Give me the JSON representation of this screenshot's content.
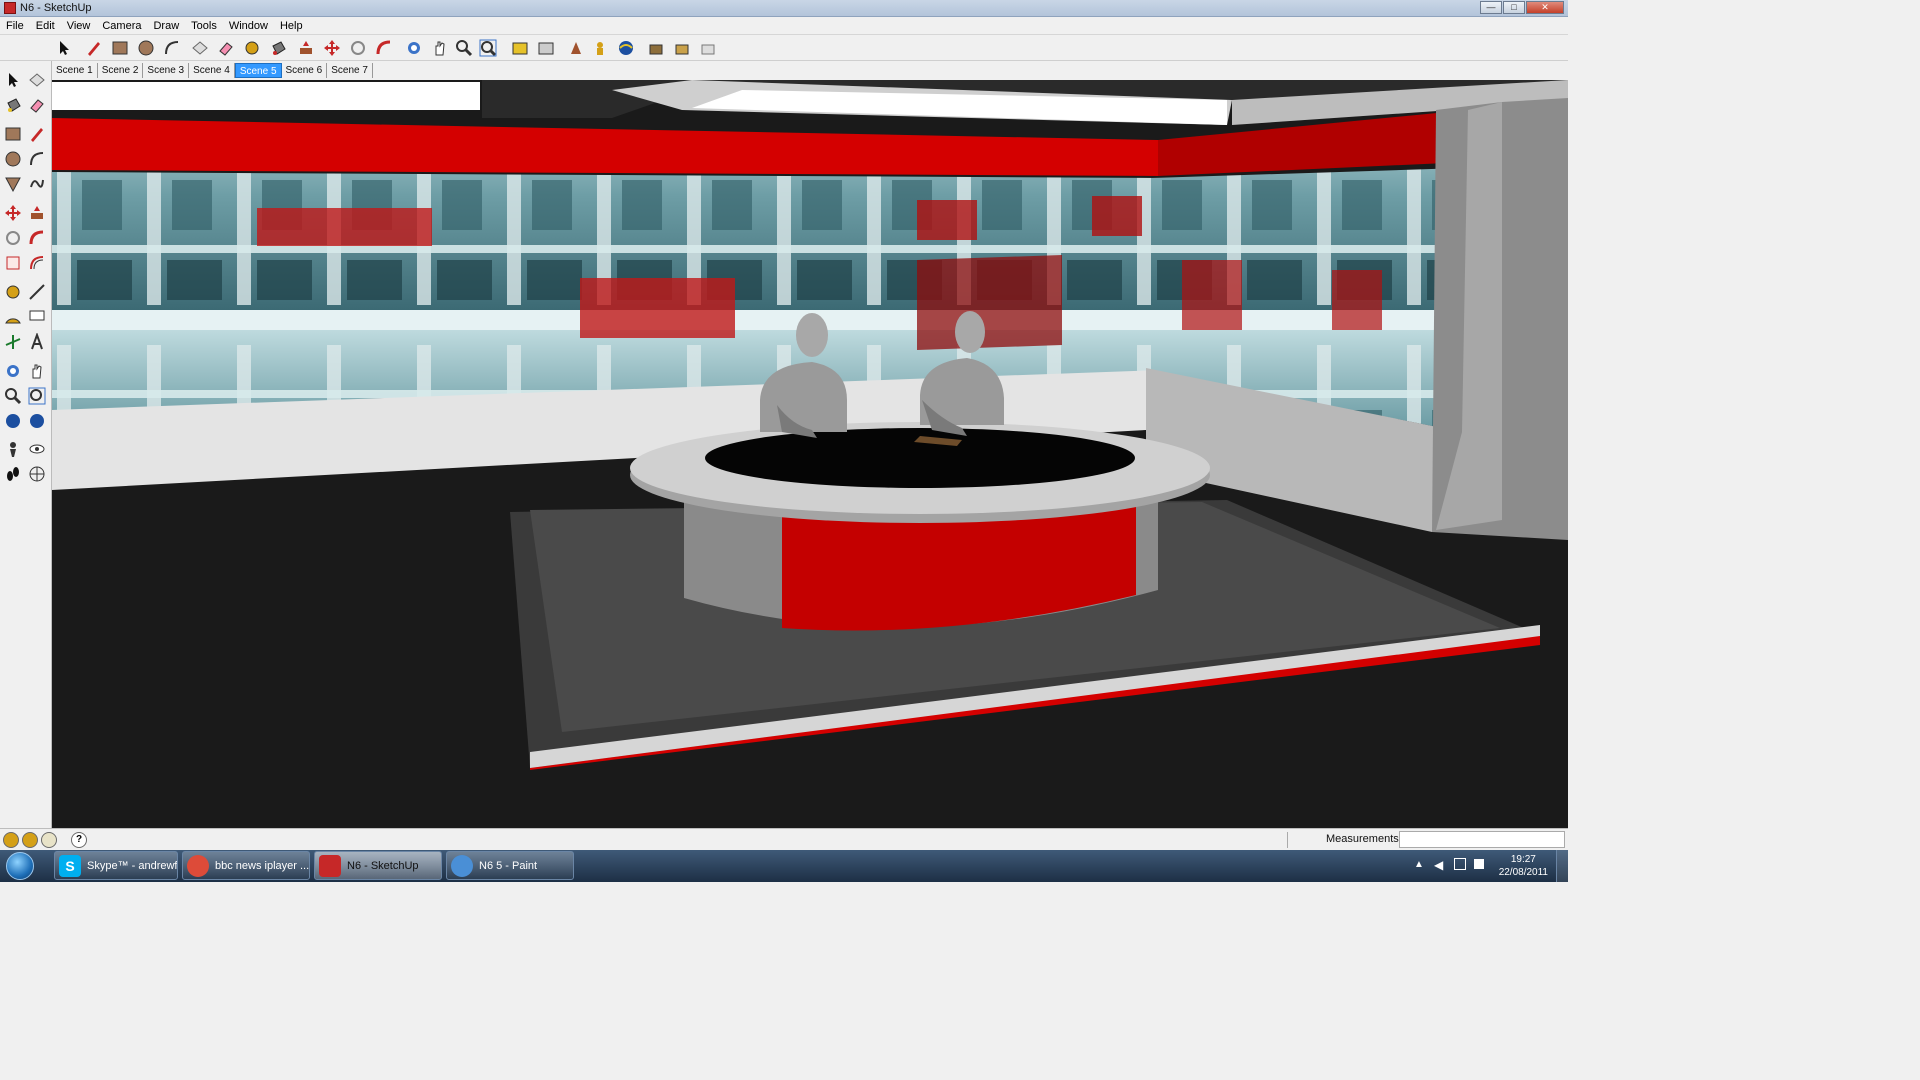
{
  "window": {
    "title": "N6 - SketchUp",
    "controls": {
      "minimize": "—",
      "maximize": "□",
      "close": "✕"
    }
  },
  "menu": [
    "File",
    "Edit",
    "View",
    "Camera",
    "Draw",
    "Tools",
    "Window",
    "Help"
  ],
  "toolbar_icons": [
    "select-icon",
    "pencil-icon",
    "rectangle-icon",
    "circle-icon",
    "arc-icon",
    "make-component-icon",
    "eraser-icon",
    "tape-measure-icon",
    "paint-bucket-icon",
    "push-pull-icon",
    "move-icon",
    "rotate-icon",
    "follow-me-icon",
    "orbit-icon",
    "pan-icon",
    "zoom-icon",
    "zoom-extents-icon",
    "get-models-icon",
    "share-model-icon",
    "3d-warehouse-icon",
    "position-camera-icon",
    "look-around-icon",
    "walk-icon",
    "components-icon",
    "materials-icon",
    "styles-icon"
  ],
  "scenes": {
    "tabs": [
      "Scene 1",
      "Scene 2",
      "Scene 3",
      "Scene 4",
      "Scene 5",
      "Scene 6",
      "Scene 7"
    ],
    "active": "Scene 5"
  },
  "status": {
    "measurements_label": "Measurements",
    "measurements_value": "",
    "help_icon": "?"
  },
  "taskbar": {
    "items": [
      {
        "label": "Skype™ - andrewf...",
        "icon": "skype-icon",
        "color": "#00aff0"
      },
      {
        "label": "bbc news iplayer ...",
        "icon": "chrome-icon",
        "color": "#dd4b39"
      },
      {
        "label": "N6 - SketchUp",
        "icon": "sketchup-icon",
        "color": "#c62828",
        "active": true
      },
      {
        "label": "N6 5 - Paint",
        "icon": "paint-icon",
        "color": "#4a8fd6"
      }
    ],
    "clock": {
      "time": "19:27",
      "date": "22/08/2011"
    }
  },
  "colors": {
    "set_red": "#d40000",
    "set_dark_red": "#b00000",
    "floor": "#1a1a1a",
    "platform": "#3a3a3a",
    "desk_top": "#c8c8c8",
    "wall_white": "#e8e8e8",
    "accent_blue": "#3399ff"
  }
}
